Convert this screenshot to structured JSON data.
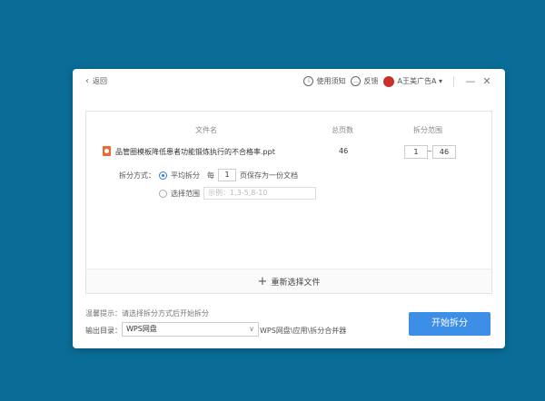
{
  "titlebar": {
    "back_label": "返回",
    "help_label": "使用须知",
    "feedback_label": "反馈",
    "user_label": "A王美广告A ▾",
    "minimize": "—",
    "close": "✕"
  },
  "table": {
    "headers": {
      "filename": "文件名",
      "total_pages": "总页数",
      "range": "拆分范围"
    },
    "file": {
      "name": "品管圈模板降低患者功能锻炼执行的不合格率.ppt",
      "pages": "46",
      "range_start": "1",
      "range_end": "46"
    }
  },
  "split": {
    "mode_label": "拆分方式：",
    "avg_label": "平均拆分",
    "every_label": "每",
    "every_value": "1",
    "every_suffix": "页保存为一份文档",
    "range_label": "选择范围",
    "range_placeholder": "示例：1,3-5,8-10"
  },
  "reselect_label": "重新选择文件",
  "footer": {
    "tip": "温馨提示：请选择拆分方式后开始拆分",
    "output_label": "输出目录：",
    "output_value": "WPS网盘",
    "output_path": "WPS网盘\\应用\\拆分合并器",
    "start_label": "开始拆分"
  },
  "colors": {
    "background": "#0a6d98",
    "accent": "#3c8ee6",
    "ppt_icon": "#e96a35"
  },
  "icons": {
    "back": "chevron-left-icon",
    "help": "info-icon",
    "feedback": "chat-icon",
    "file": "ppt-icon",
    "add": "plus-icon"
  }
}
